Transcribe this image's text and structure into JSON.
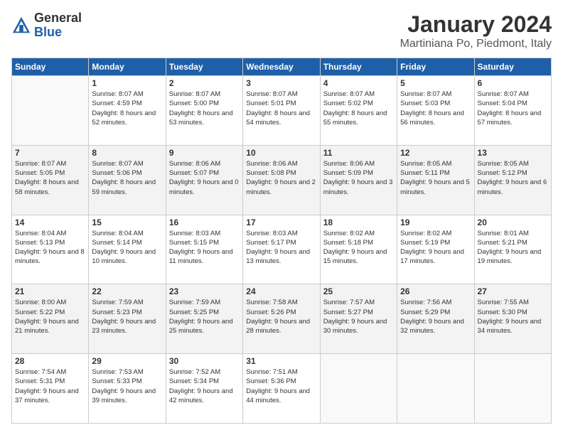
{
  "logo": {
    "general": "General",
    "blue": "Blue"
  },
  "title": "January 2024",
  "location": "Martiniana Po, Piedmont, Italy",
  "weekdays": [
    "Sunday",
    "Monday",
    "Tuesday",
    "Wednesday",
    "Thursday",
    "Friday",
    "Saturday"
  ],
  "weeks": [
    [
      {
        "day": "",
        "sunrise": "",
        "sunset": "",
        "daylight": "",
        "empty": true
      },
      {
        "day": "1",
        "sunrise": "Sunrise: 8:07 AM",
        "sunset": "Sunset: 4:59 PM",
        "daylight": "Daylight: 8 hours and 52 minutes."
      },
      {
        "day": "2",
        "sunrise": "Sunrise: 8:07 AM",
        "sunset": "Sunset: 5:00 PM",
        "daylight": "Daylight: 8 hours and 53 minutes."
      },
      {
        "day": "3",
        "sunrise": "Sunrise: 8:07 AM",
        "sunset": "Sunset: 5:01 PM",
        "daylight": "Daylight: 8 hours and 54 minutes."
      },
      {
        "day": "4",
        "sunrise": "Sunrise: 8:07 AM",
        "sunset": "Sunset: 5:02 PM",
        "daylight": "Daylight: 8 hours and 55 minutes."
      },
      {
        "day": "5",
        "sunrise": "Sunrise: 8:07 AM",
        "sunset": "Sunset: 5:03 PM",
        "daylight": "Daylight: 8 hours and 56 minutes."
      },
      {
        "day": "6",
        "sunrise": "Sunrise: 8:07 AM",
        "sunset": "Sunset: 5:04 PM",
        "daylight": "Daylight: 8 hours and 57 minutes."
      }
    ],
    [
      {
        "day": "7",
        "sunrise": "Sunrise: 8:07 AM",
        "sunset": "Sunset: 5:05 PM",
        "daylight": "Daylight: 8 hours and 58 minutes."
      },
      {
        "day": "8",
        "sunrise": "Sunrise: 8:07 AM",
        "sunset": "Sunset: 5:06 PM",
        "daylight": "Daylight: 8 hours and 59 minutes."
      },
      {
        "day": "9",
        "sunrise": "Sunrise: 8:06 AM",
        "sunset": "Sunset: 5:07 PM",
        "daylight": "Daylight: 9 hours and 0 minutes."
      },
      {
        "day": "10",
        "sunrise": "Sunrise: 8:06 AM",
        "sunset": "Sunset: 5:08 PM",
        "daylight": "Daylight: 9 hours and 2 minutes."
      },
      {
        "day": "11",
        "sunrise": "Sunrise: 8:06 AM",
        "sunset": "Sunset: 5:09 PM",
        "daylight": "Daylight: 9 hours and 3 minutes."
      },
      {
        "day": "12",
        "sunrise": "Sunrise: 8:05 AM",
        "sunset": "Sunset: 5:11 PM",
        "daylight": "Daylight: 9 hours and 5 minutes."
      },
      {
        "day": "13",
        "sunrise": "Sunrise: 8:05 AM",
        "sunset": "Sunset: 5:12 PM",
        "daylight": "Daylight: 9 hours and 6 minutes."
      }
    ],
    [
      {
        "day": "14",
        "sunrise": "Sunrise: 8:04 AM",
        "sunset": "Sunset: 5:13 PM",
        "daylight": "Daylight: 9 hours and 8 minutes."
      },
      {
        "day": "15",
        "sunrise": "Sunrise: 8:04 AM",
        "sunset": "Sunset: 5:14 PM",
        "daylight": "Daylight: 9 hours and 10 minutes."
      },
      {
        "day": "16",
        "sunrise": "Sunrise: 8:03 AM",
        "sunset": "Sunset: 5:15 PM",
        "daylight": "Daylight: 9 hours and 11 minutes."
      },
      {
        "day": "17",
        "sunrise": "Sunrise: 8:03 AM",
        "sunset": "Sunset: 5:17 PM",
        "daylight": "Daylight: 9 hours and 13 minutes."
      },
      {
        "day": "18",
        "sunrise": "Sunrise: 8:02 AM",
        "sunset": "Sunset: 5:18 PM",
        "daylight": "Daylight: 9 hours and 15 minutes."
      },
      {
        "day": "19",
        "sunrise": "Sunrise: 8:02 AM",
        "sunset": "Sunset: 5:19 PM",
        "daylight": "Daylight: 9 hours and 17 minutes."
      },
      {
        "day": "20",
        "sunrise": "Sunrise: 8:01 AM",
        "sunset": "Sunset: 5:21 PM",
        "daylight": "Daylight: 9 hours and 19 minutes."
      }
    ],
    [
      {
        "day": "21",
        "sunrise": "Sunrise: 8:00 AM",
        "sunset": "Sunset: 5:22 PM",
        "daylight": "Daylight: 9 hours and 21 minutes."
      },
      {
        "day": "22",
        "sunrise": "Sunrise: 7:59 AM",
        "sunset": "Sunset: 5:23 PM",
        "daylight": "Daylight: 9 hours and 23 minutes."
      },
      {
        "day": "23",
        "sunrise": "Sunrise: 7:59 AM",
        "sunset": "Sunset: 5:25 PM",
        "daylight": "Daylight: 9 hours and 25 minutes."
      },
      {
        "day": "24",
        "sunrise": "Sunrise: 7:58 AM",
        "sunset": "Sunset: 5:26 PM",
        "daylight": "Daylight: 9 hours and 28 minutes."
      },
      {
        "day": "25",
        "sunrise": "Sunrise: 7:57 AM",
        "sunset": "Sunset: 5:27 PM",
        "daylight": "Daylight: 9 hours and 30 minutes."
      },
      {
        "day": "26",
        "sunrise": "Sunrise: 7:56 AM",
        "sunset": "Sunset: 5:29 PM",
        "daylight": "Daylight: 9 hours and 32 minutes."
      },
      {
        "day": "27",
        "sunrise": "Sunrise: 7:55 AM",
        "sunset": "Sunset: 5:30 PM",
        "daylight": "Daylight: 9 hours and 34 minutes."
      }
    ],
    [
      {
        "day": "28",
        "sunrise": "Sunrise: 7:54 AM",
        "sunset": "Sunset: 5:31 PM",
        "daylight": "Daylight: 9 hours and 37 minutes."
      },
      {
        "day": "29",
        "sunrise": "Sunrise: 7:53 AM",
        "sunset": "Sunset: 5:33 PM",
        "daylight": "Daylight: 9 hours and 39 minutes."
      },
      {
        "day": "30",
        "sunrise": "Sunrise: 7:52 AM",
        "sunset": "Sunset: 5:34 PM",
        "daylight": "Daylight: 9 hours and 42 minutes."
      },
      {
        "day": "31",
        "sunrise": "Sunrise: 7:51 AM",
        "sunset": "Sunset: 5:36 PM",
        "daylight": "Daylight: 9 hours and 44 minutes."
      },
      {
        "day": "",
        "sunrise": "",
        "sunset": "",
        "daylight": "",
        "empty": true
      },
      {
        "day": "",
        "sunrise": "",
        "sunset": "",
        "daylight": "",
        "empty": true
      },
      {
        "day": "",
        "sunrise": "",
        "sunset": "",
        "daylight": "",
        "empty": true
      }
    ]
  ]
}
